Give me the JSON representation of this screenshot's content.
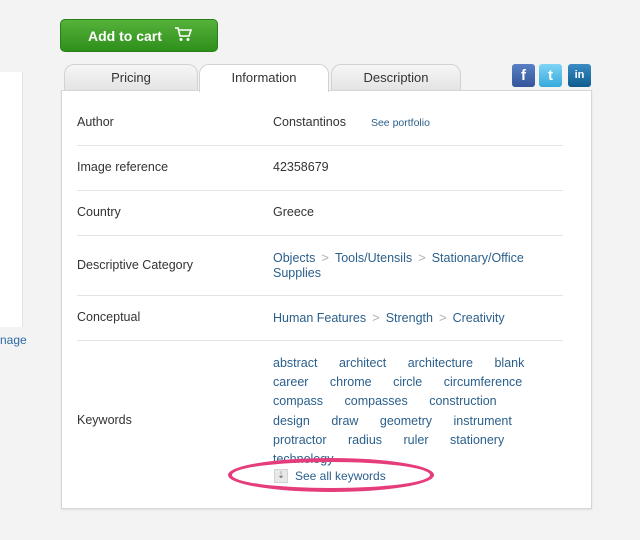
{
  "cart_button": {
    "label": "Add to cart",
    "icon": "cart-icon"
  },
  "left_fragment": {
    "link_text": "nage"
  },
  "tabs": [
    {
      "label": "Pricing"
    },
    {
      "label": "Information"
    },
    {
      "label": "Description"
    }
  ],
  "social": {
    "facebook": "f",
    "twitter": "t",
    "linkedin": "in"
  },
  "info": {
    "author_label": "Author",
    "author_value": "Constantinos",
    "author_link": "See portfolio",
    "ref_label": "Image reference",
    "ref_value": "42358679",
    "country_label": "Country",
    "country_value": "Greece",
    "desc_cat_label": "Descriptive Category",
    "desc_cat": [
      "Objects",
      "Tools/Utensils",
      "Stationary/Office Supplies"
    ],
    "conceptual_label": "Conceptual",
    "conceptual": [
      "Human Features",
      "Strength",
      "Creativity"
    ],
    "keywords_label": "Keywords",
    "keywords": [
      "abstract",
      "architect",
      "architecture",
      "blank",
      "career",
      "chrome",
      "circle",
      "circumference",
      "compass",
      "compasses",
      "construction",
      "design",
      "draw",
      "geometry",
      "instrument",
      "protractor",
      "radius",
      "ruler",
      "stationery",
      "technology"
    ],
    "see_all": "See all keywords"
  },
  "colors": {
    "cart_green": "#3fa22a",
    "link_blue": "#2b5f8c",
    "highlight_pink": "#e53d7c"
  }
}
